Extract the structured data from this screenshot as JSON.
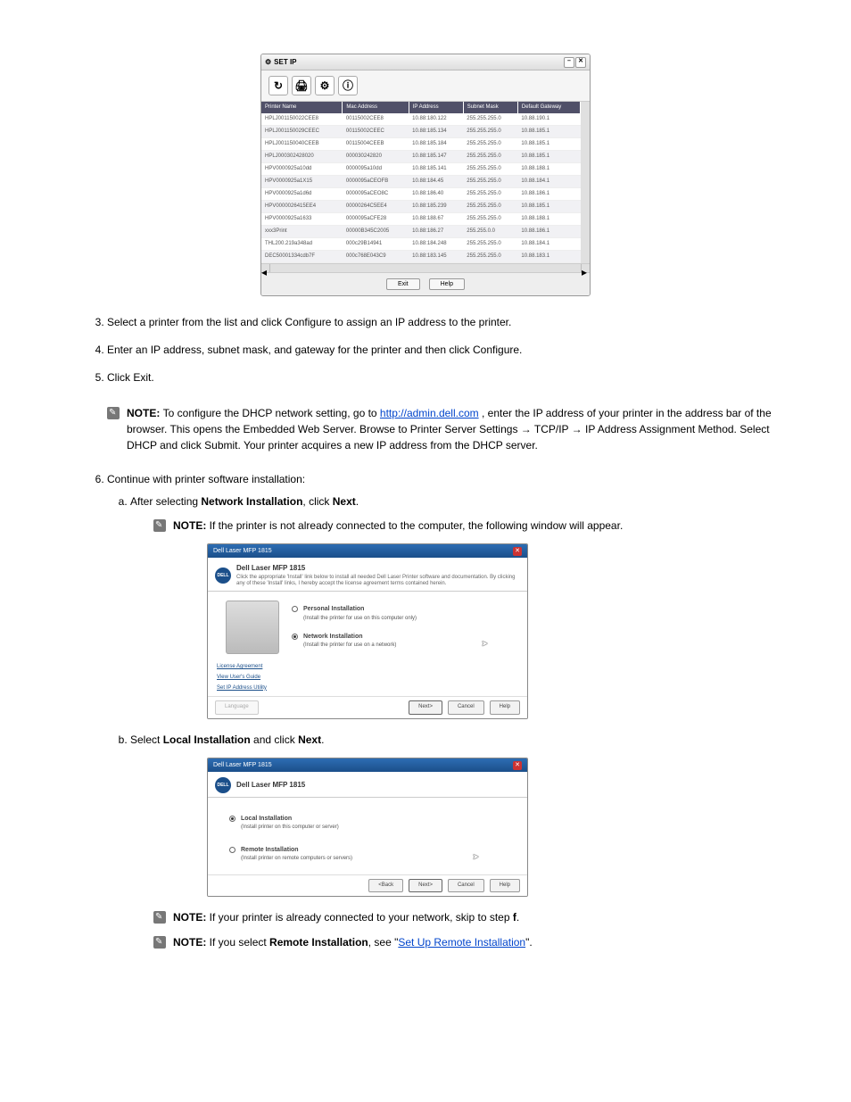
{
  "setip": {
    "title": "SET IP",
    "toolbar_icons": [
      "↻",
      "🖨",
      "⚙",
      "ⓘ"
    ],
    "headers": [
      "Printer Name",
      "Mac Address",
      "IP Address",
      "Subnet Mask",
      "Default Gateway"
    ],
    "rows": [
      {
        "c": [
          "HPLJ001150022CEE8",
          "00115002CEE8",
          "10.88:180.122",
          "255.255.255.0",
          "10.88.190.1"
        ]
      },
      {
        "c": [
          "HPLJ001150029CEEC",
          "00115002CEEC",
          "10.88:185.134",
          "255.255.255.0",
          "10.88.185.1"
        ]
      },
      {
        "c": [
          "HPLJ001150040CEEB",
          "00115004CEEB",
          "10.88:185.184",
          "255.255.255.0",
          "10.88.185.1"
        ]
      },
      {
        "c": [
          "HPLJ000302428020",
          "000030242820",
          "10.88:185.147",
          "255.255.255.0",
          "10.88.185.1"
        ]
      },
      {
        "c": [
          "HPV0000925a10dd",
          "0000095a10dd",
          "10.88:185.141",
          "255.255.255.0",
          "10.88.188.1"
        ]
      },
      {
        "c": [
          "HPV0000925a1X15",
          "0000095aCEOFB",
          "10.88:184.45",
          "255.255.255.0",
          "10.88.184.1"
        ]
      },
      {
        "c": [
          "HPV0000925a1d6d",
          "0000095aCEO8C",
          "10.88:186.40",
          "255.255.255.0",
          "10.88.186.1"
        ]
      },
      {
        "c": [
          "HPV0000026415EE4",
          "00000264C5EE4",
          "10.88:185.239",
          "255.255.255.0",
          "10.88.185.1"
        ]
      },
      {
        "c": [
          "HPV0000925a1633",
          "0000095aCFE28",
          "10.88:188.67",
          "255.255.255.0",
          "10.88.188.1"
        ]
      },
      {
        "c": [
          "xxx3Print",
          "00000B345C2005",
          "10.88:186.27",
          "255.255.0.0",
          "10.88.186.1"
        ]
      },
      {
        "c": [
          "THL200.219a348ad",
          "000c29B14941",
          "10.88:184.248",
          "255.255.255.0",
          "10.88.184.1"
        ]
      },
      {
        "c": [
          "DEC50001334cdb7F",
          "000c768E043C9",
          "10.88:183.145",
          "255.255.255.0",
          "10.88.183.1"
        ]
      }
    ],
    "buttons": {
      "exit": "Exit",
      "help": "Help"
    }
  },
  "body": {
    "step3": "Select a printer from the list and click Configure to assign an IP address to the printer.",
    "step4": "Enter an IP address, subnet mask, and gateway for the printer and then click Configure.",
    "step5": "Click Exit.",
    "note1a": "NOTE: ",
    "note1b": "To configure the DHCP network setting, go to ",
    "note1c": ", enter the IP address of your printer in the address bar of the browser. This opens the Embedded Web Server. Browse to Printer Server Settings → TCP/IP → IP Address Assignment Method. Select DHCP and click Submit. Your printer acquires a new IP address from the DHCP server.",
    "url1": "http://admin.dell.com",
    "heading1": "Continue with printer software installation:",
    "stepA": "After selecting Network Installation, click Next.",
    "noteA": "NOTE: ",
    "noteA2": "If the printer is not already connected to the computer, the following window will appear.",
    "stepB": "Select Local Installation and click Next.",
    "noteB": "NOTE: ",
    "noteB2": "If your printer is already connected to your network, skip to step f.",
    "noteC": "NOTE: ",
    "noteC2": "If you select Remote Installation, see \"Set Up Remote Installation\"."
  },
  "install1": {
    "titlebar": "Dell Laser MFP 1815",
    "header_big": "Dell Laser MFP 1815",
    "header_small": "Click the appropriate 'Install' link below to install all needed Dell Laser Printer software and documentation. By clicking any of these 'Install' links, I hereby accept the license agreement terms contained herein.",
    "opt1_head": "Personal Installation",
    "opt1_sub": "(Install the printer for use on this computer only)",
    "opt2_head": "Network Installation",
    "opt2_sub": "(Install the printer for use on a network)",
    "links": [
      "License Agreement",
      "View User's Guide",
      "Set IP Address Utility"
    ],
    "btns": {
      "lang": "Language",
      "next": "Next>",
      "cancel": "Cancel",
      "help": "Help"
    }
  },
  "install2": {
    "titlebar": "Dell Laser MFP 1815",
    "header_big": "Dell Laser MFP 1815",
    "opt1_head": "Local Installation",
    "opt1_sub": "(Install printer on this computer or server)",
    "opt2_head": "Remote Installation",
    "opt2_sub": "(Install printer on remote computers or servers)",
    "btns": {
      "back": "<Back",
      "next": "Next>",
      "cancel": "Cancel",
      "help": "Help"
    }
  }
}
